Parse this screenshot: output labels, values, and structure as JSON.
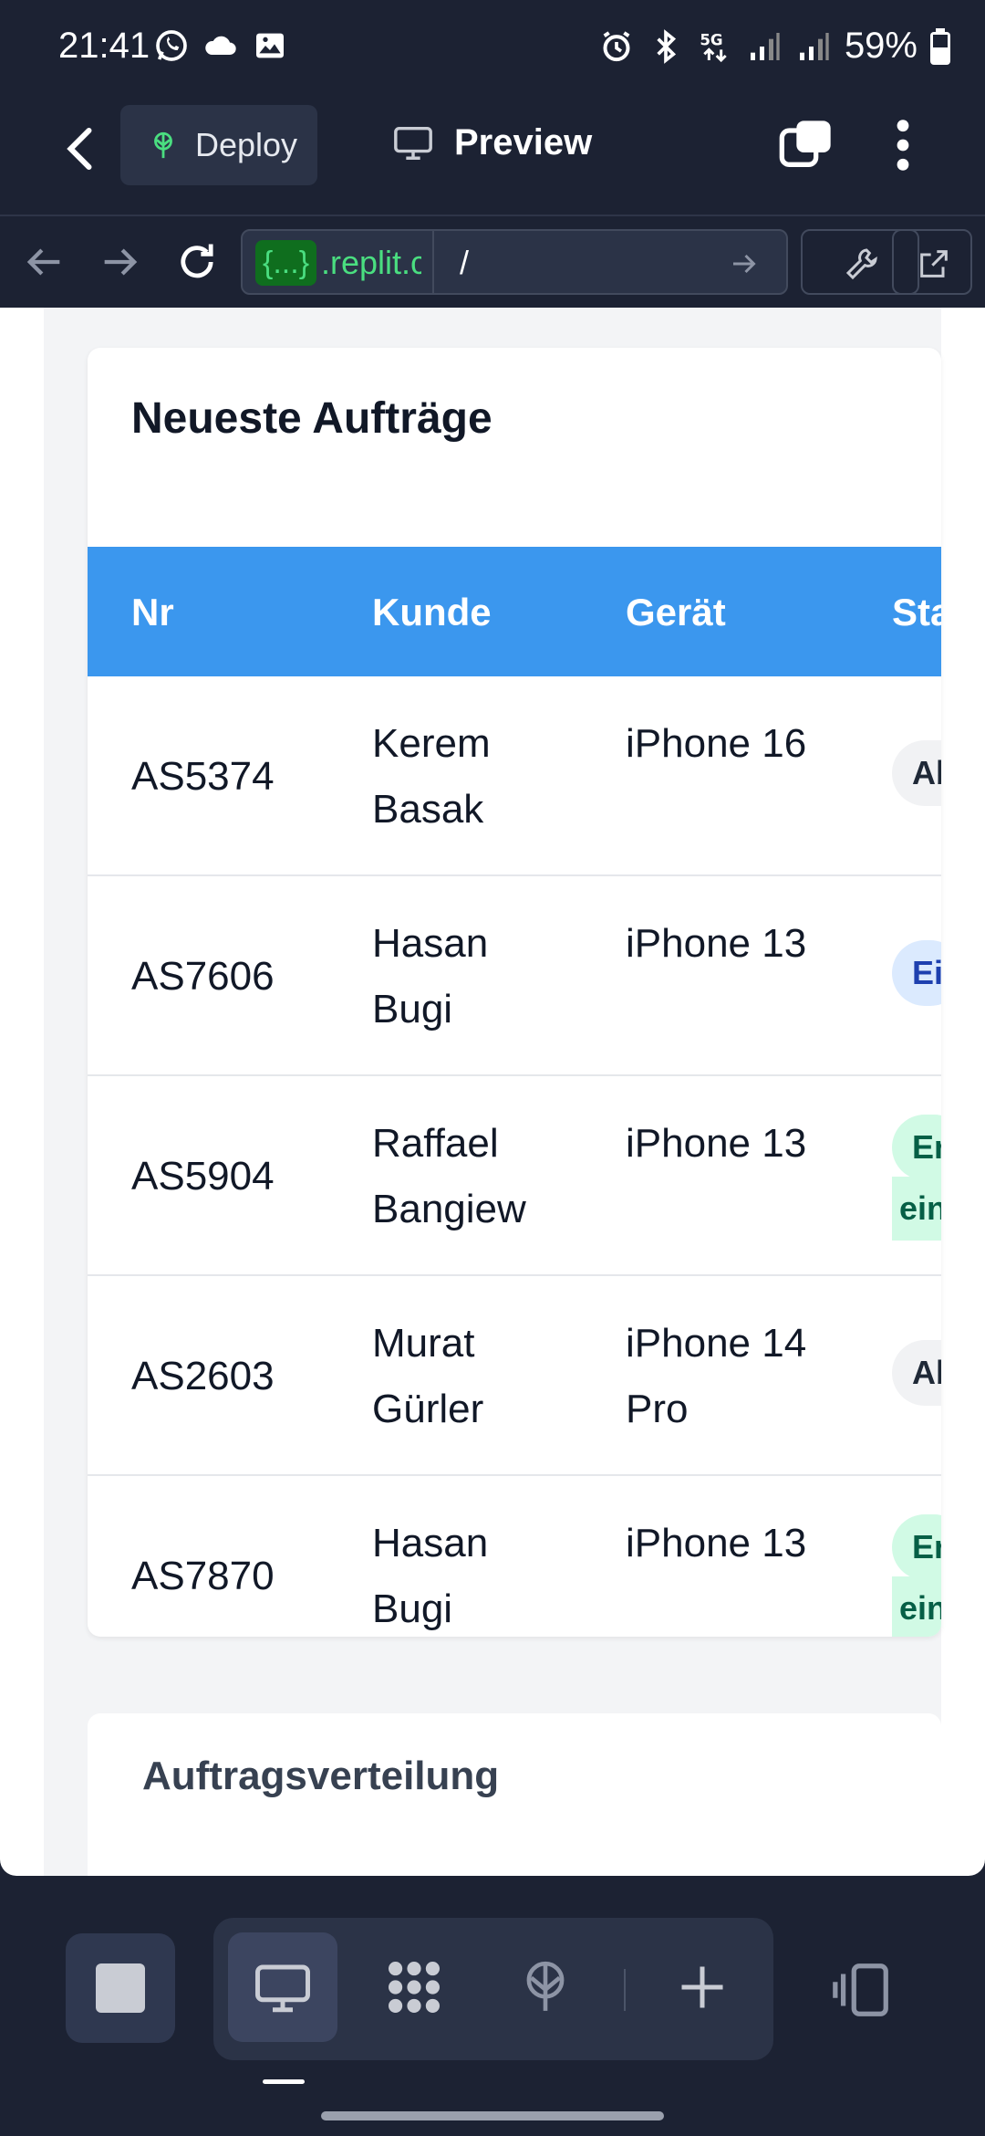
{
  "status_bar": {
    "time": "21:41",
    "battery": "59%",
    "left_icons": [
      "whatsapp-icon",
      "cloud-icon",
      "gallery-icon"
    ],
    "right_icons": [
      "alarm-icon",
      "bluetooth-icon",
      "5g-icon",
      "signal-icon",
      "signal-icon",
      "battery-icon"
    ]
  },
  "app_bar": {
    "deploy_label": "Deploy",
    "preview_label": "Preview"
  },
  "browser": {
    "url_badge": "{...}",
    "url_host": ".replit.c",
    "url_path": "/"
  },
  "orders_card": {
    "title": "Neueste Aufträge",
    "columns": [
      "Nr",
      "Kunde",
      "Gerät",
      "Sta"
    ],
    "rows": [
      {
        "nr": "AS5374",
        "kunde": "Kerem Basak",
        "geraet": "iPhone 16",
        "status": "Ab",
        "status_style": "gray"
      },
      {
        "nr": "AS7606",
        "kunde": "Hasan Bugi",
        "geraet": "iPhone 13",
        "status": "Ei",
        "status_style": "blue"
      },
      {
        "nr": "AS5904",
        "kunde": "Raffael Bangiew",
        "geraet": "iPhone 13",
        "status": "Er",
        "status_cont": "eing",
        "status_style": "green"
      },
      {
        "nr": "AS2603",
        "kunde": "Murat Gürler",
        "geraet": "iPhone 14 Pro",
        "status": "Ab",
        "status_style": "gray"
      },
      {
        "nr": "AS7870",
        "kunde": "Hasan Bugi",
        "geraet": "iPhone 13",
        "status": "Er",
        "status_cont": "eing",
        "status_style": "green"
      }
    ]
  },
  "distribution_card": {
    "title": "Auftragsverteilung"
  },
  "colors": {
    "header_blue": "#3b97ee",
    "app_dark": "#1c2233",
    "replit_green": "#4ade80"
  }
}
